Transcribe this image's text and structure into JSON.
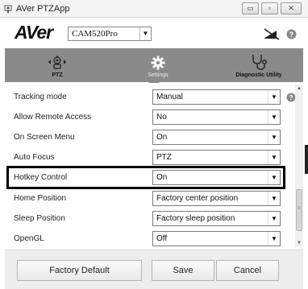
{
  "window": {
    "title": "AVer PTZApp",
    "minimize_glyph": "▭",
    "restore_glyph": "▫",
    "close_glyph": "✕"
  },
  "brand": {
    "logo_text": "AVer",
    "camera_select": "CAM520Pro"
  },
  "tabs": [
    {
      "label": "PTZ",
      "icon": "ptz-icon"
    },
    {
      "label": "Settings",
      "icon": "gear-icon"
    },
    {
      "label": "Diagnostic Utility",
      "icon": "stethoscope-icon"
    }
  ],
  "settings": [
    {
      "label": "Tracking mode",
      "value": "Manual"
    },
    {
      "label": "Allow Remote Access",
      "value": "No"
    },
    {
      "label": "On Screen Menu",
      "value": "On"
    },
    {
      "label": "Auto Focus",
      "value": "PTZ"
    },
    {
      "label": "Hotkey Control",
      "value": "On"
    },
    {
      "label": "Home Position",
      "value": "Factory center position"
    },
    {
      "label": "Sleep Position",
      "value": "Factory sleep position"
    },
    {
      "label": "OpenGL",
      "value": "Off"
    }
  ],
  "buttons": {
    "factory_default": "Factory Default",
    "save": "Save",
    "cancel": "Cancel"
  },
  "colors": {
    "tab_bar": "#8a8a8a",
    "highlight_border": "#000000",
    "help_icon": "#888888"
  }
}
